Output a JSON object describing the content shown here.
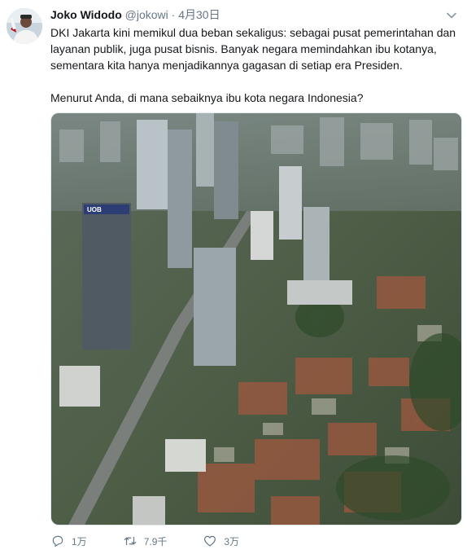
{
  "tweet": {
    "author_name": "Joko Widodo",
    "handle": "@jokowi",
    "separator": "·",
    "date": "4月30日",
    "paragraphs": [
      "DKI Jakarta kini memikul dua beban sekaligus: sebagai pusat pemerintahan dan layanan publik, juga pusat bisnis. Banyak negara memindahkan ibu kotanya, sementara kita hanya menjadikannya gagasan di setiap era Presiden.",
      "Menurut Anda, di mana sebaiknya ibu kota negara Indonesia?"
    ],
    "building_sign": "UOB"
  },
  "actions": {
    "replies": "1万",
    "retweets": "7.9千",
    "likes": "3万"
  },
  "colors": {
    "text": "#14171a",
    "secondary": "#657786",
    "border": "#e1e8ed"
  },
  "icons": [
    "chevron-down-icon",
    "reply-icon",
    "retweet-icon",
    "like-icon"
  ]
}
